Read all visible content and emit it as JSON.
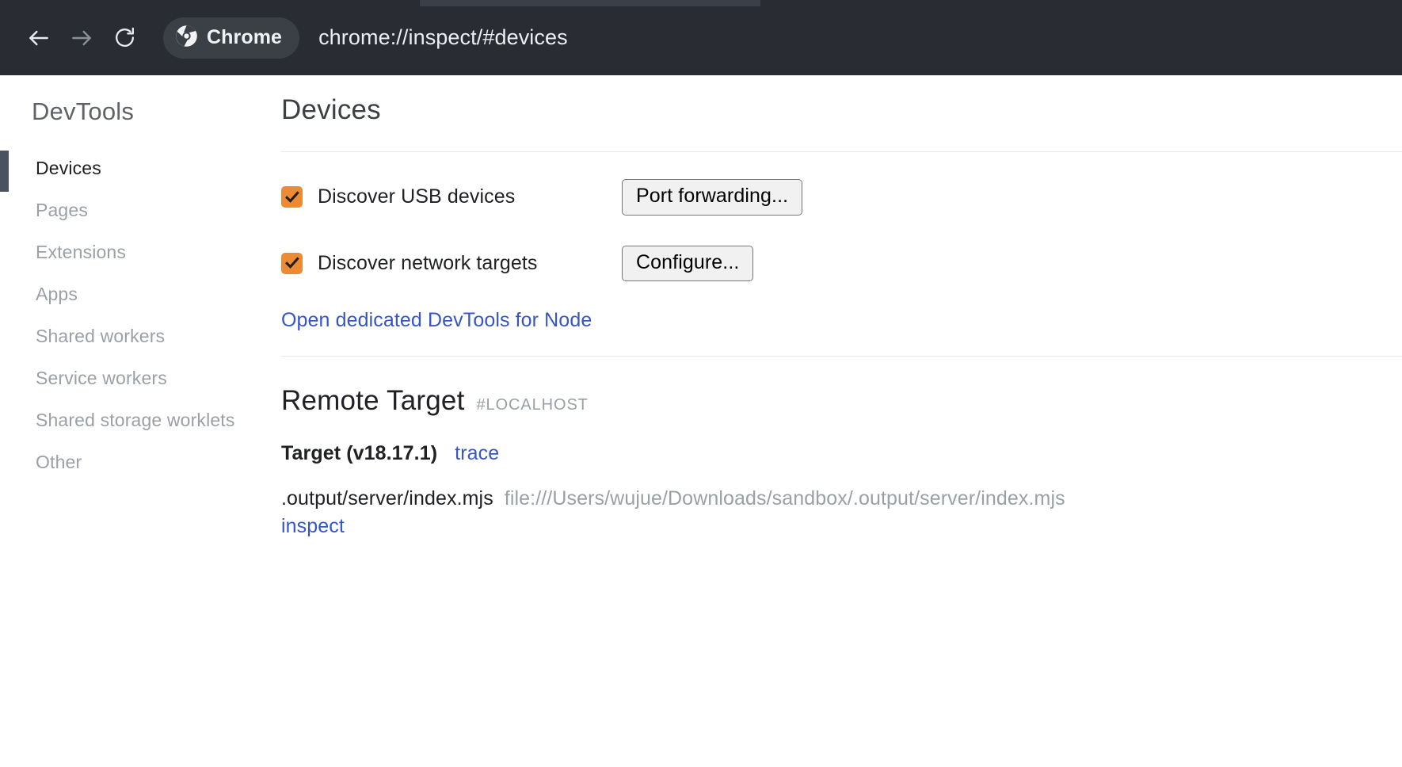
{
  "browser": {
    "back_icon": "arrow-left-icon",
    "forward_icon": "arrow-right-icon",
    "reload_icon": "reload-icon",
    "chip_label": "Chrome",
    "chip_icon": "chrome-logo-icon",
    "url": "chrome://inspect/#devices"
  },
  "sidebar": {
    "title": "DevTools",
    "items": [
      {
        "label": "Devices",
        "active": true
      },
      {
        "label": "Pages",
        "active": false
      },
      {
        "label": "Extensions",
        "active": false
      },
      {
        "label": "Apps",
        "active": false
      },
      {
        "label": "Shared workers",
        "active": false
      },
      {
        "label": "Service workers",
        "active": false
      },
      {
        "label": "Shared storage worklets",
        "active": false
      },
      {
        "label": "Other",
        "active": false
      }
    ]
  },
  "main": {
    "heading": "Devices",
    "options": [
      {
        "label": "Discover USB devices",
        "checked": true,
        "button": "Port forwarding..."
      },
      {
        "label": "Discover network targets",
        "checked": true,
        "button": "Configure..."
      }
    ],
    "node_link": "Open dedicated DevTools for Node",
    "remote_target": {
      "title": "Remote Target",
      "subtitle": "#LOCALHOST",
      "target_name": "Target (v18.17.1)",
      "trace_link": "trace",
      "detail_name": ".output/server/index.mjs",
      "detail_url": "file:///Users/wujue/Downloads/sandbox/.output/server/index.mjs",
      "inspect_link": "inspect"
    }
  },
  "colors": {
    "toolbar_bg": "#292d33",
    "checkbox_orange": "#ec8b33",
    "link_blue": "#3656c8",
    "active_indicator": "#4a525e"
  }
}
